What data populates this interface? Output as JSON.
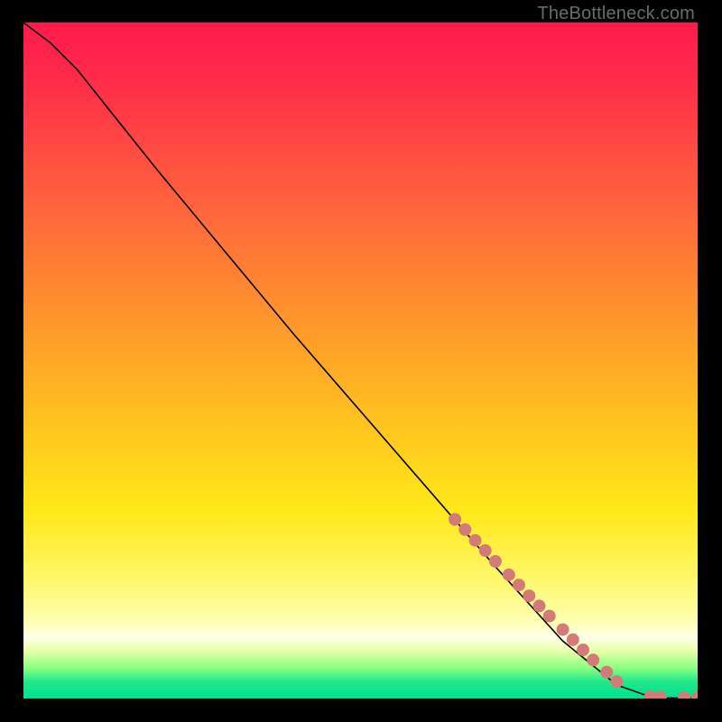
{
  "watermark": "TheBottleneck.com",
  "chart_data": {
    "type": "line",
    "title": "",
    "xlabel": "",
    "ylabel": "",
    "xlim": [
      0,
      100
    ],
    "ylim": [
      0,
      100
    ],
    "grid": false,
    "legend": false,
    "series": [
      {
        "name": "curve",
        "stroke": "#000000",
        "x": [
          0,
          4,
          8,
          12,
          20,
          30,
          40,
          50,
          60,
          70,
          80,
          88,
          92,
          95,
          97,
          100
        ],
        "y": [
          100,
          97,
          93,
          88,
          78,
          66,
          54,
          42.5,
          31,
          19.5,
          8.5,
          2,
          0.6,
          0.1,
          0.05,
          0.05
        ]
      }
    ],
    "markers": {
      "name": "dense-region-dots",
      "fill": "#d57b77",
      "radius_px": 7,
      "x": [
        64,
        65.5,
        67,
        68.5,
        70,
        72,
        73.5,
        75,
        76.5,
        78,
        80,
        81.5,
        83,
        84.5,
        86.5,
        88,
        93,
        94.5,
        98,
        100
      ],
      "y": [
        26.5,
        25,
        23.4,
        21.9,
        20.3,
        18.3,
        16.8,
        15.2,
        13.7,
        12.2,
        10.2,
        8.7,
        7.2,
        5.7,
        3.9,
        2.5,
        0.25,
        0.2,
        0.1,
        0.1
      ]
    }
  }
}
